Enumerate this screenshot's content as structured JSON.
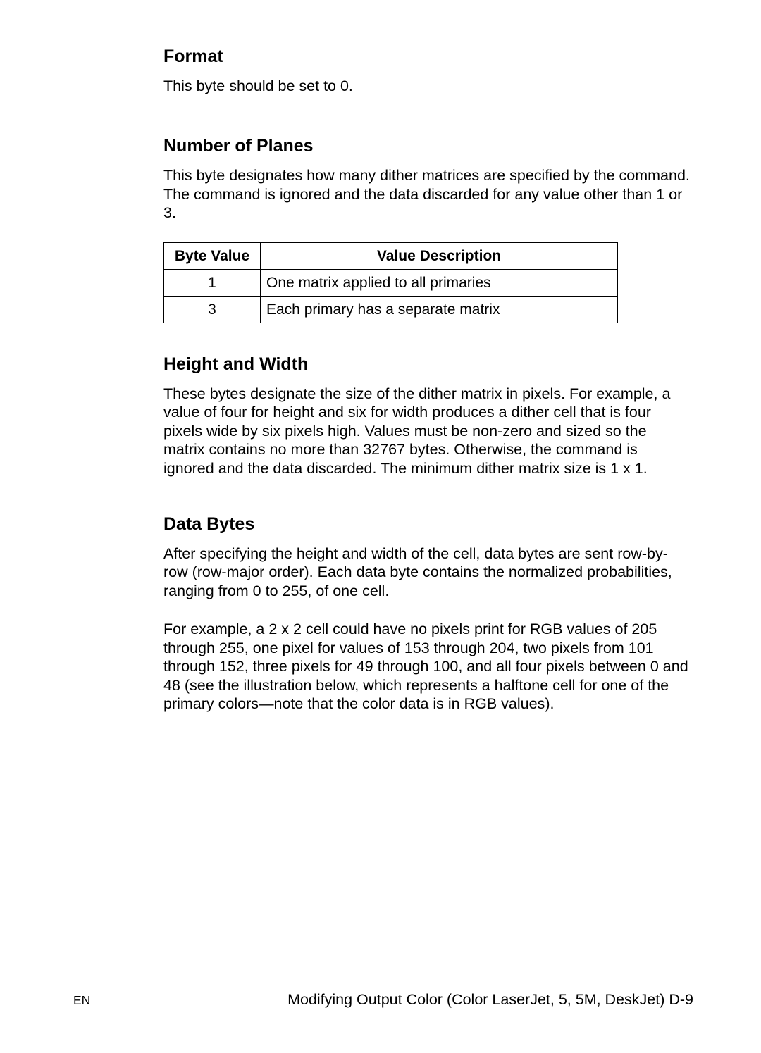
{
  "sections": {
    "format": {
      "heading": "Format",
      "body": "This byte should be set to 0."
    },
    "planes": {
      "heading": "Number of Planes",
      "body": "This byte designates how many dither matrices are specified by the command. The command is ignored and the data discarded for any value other than 1 or 3.",
      "table": {
        "headers": [
          "Byte Value",
          "Value Description"
        ],
        "rows": [
          {
            "value": "1",
            "desc": "One matrix applied to all primaries"
          },
          {
            "value": "3",
            "desc": "Each primary has a separate matrix"
          }
        ]
      }
    },
    "hw": {
      "heading": "Height and Width",
      "body": "These bytes designate the size of the dither matrix in pixels. For example, a value of four for height and six for width produces a dither cell that is four pixels wide by six pixels high. Values must be non-zero and sized so the matrix contains no more than 32767 bytes. Otherwise, the command is ignored and the data discarded. The minimum dither matrix size is 1 x 1."
    },
    "databytes": {
      "heading": "Data Bytes",
      "body1": "After specifying the height and width of the cell, data bytes are sent row-by-row (row-major order). Each data byte contains the normalized probabilities, ranging from 0 to 255, of one cell.",
      "body2": "For example, a 2 x 2 cell could have no pixels print for RGB values of 205 through 255, one pixel for values of 153 through 204, two pixels from 101 through 152, three pixels for 49 through 100, and all four pixels between 0 and 48 (see the illustration below, which represents a halftone cell for one of the primary colors—note that the color data is in RGB values)."
    }
  },
  "footer": {
    "left": "EN",
    "right": "Modifying Output Color (Color LaserJet, 5, 5M, DeskJet) D-9"
  }
}
